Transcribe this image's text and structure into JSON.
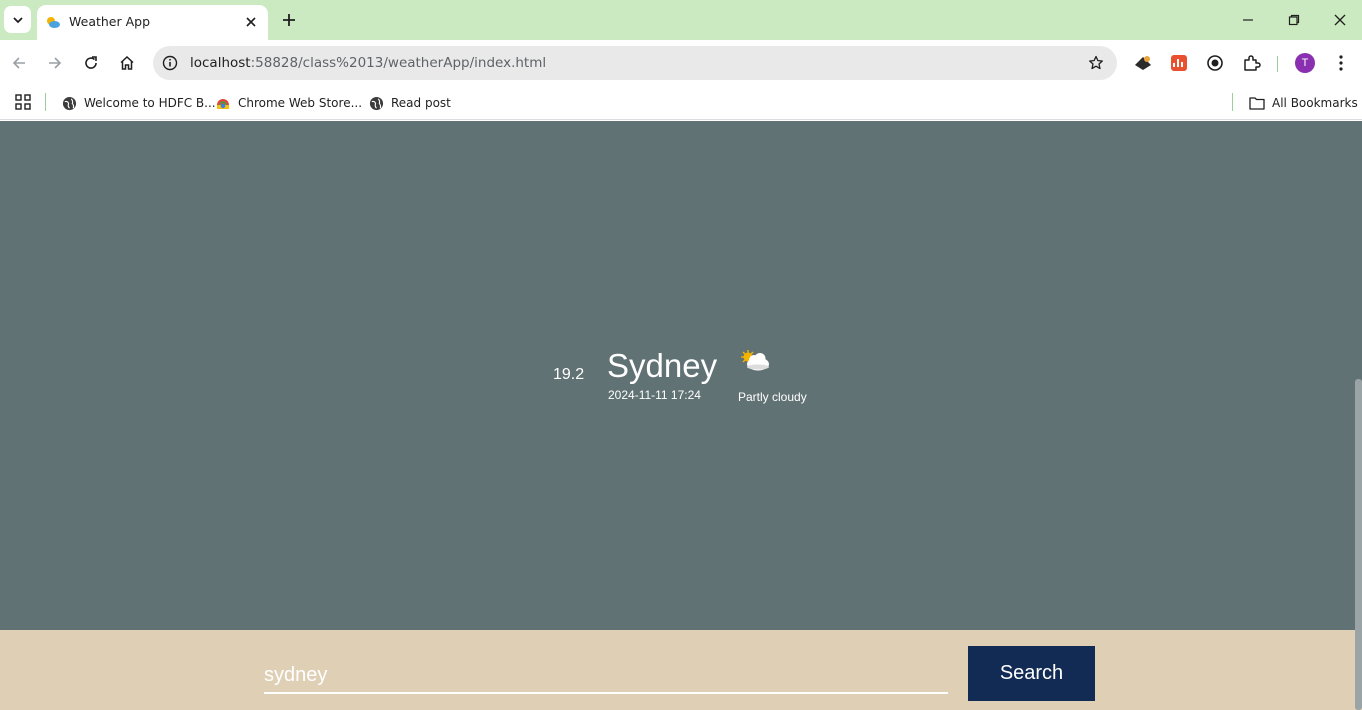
{
  "browser": {
    "tab": {
      "title": "Weather App",
      "icon": "weather-favicon-icon"
    },
    "address": {
      "host": "localhost",
      "path": ":58828/class%2013/weatherApp/index.html"
    },
    "profile_initial": "T",
    "bookmarks": [
      {
        "label": "Welcome to HDFC B...",
        "icon": "globe-icon"
      },
      {
        "label": "Chrome Web Store...",
        "icon": "chrome-web-store-icon"
      },
      {
        "label": "Read post",
        "icon": "globe-icon"
      }
    ],
    "all_bookmarks_label": "All Bookmarks"
  },
  "weather": {
    "temperature": "19.2",
    "city": "Sydney",
    "datetime": "2024-11-11 17:24",
    "condition": "Partly cloudy",
    "condition_icon": "partly-cloudy-icon"
  },
  "search": {
    "value": "sydney",
    "button_label": "Search"
  },
  "colors": {
    "weather_background": "#617275",
    "search_background": "#dfd0b5",
    "search_button": "#122b55",
    "tabstrip": "#cbeac1"
  }
}
